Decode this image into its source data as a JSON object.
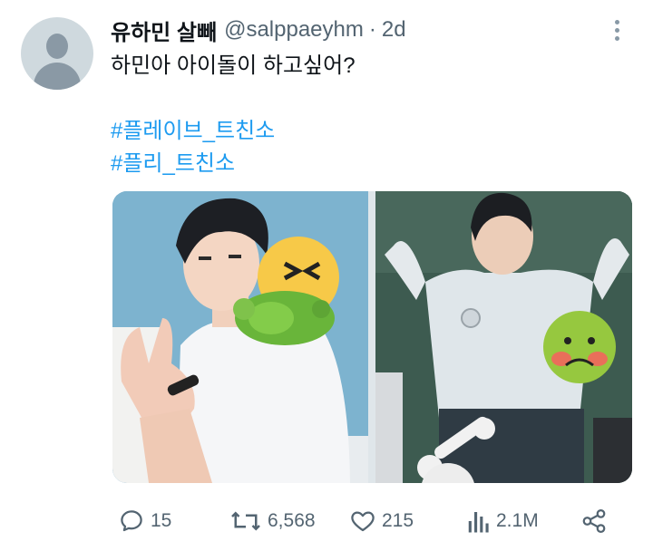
{
  "tweet": {
    "display_name": "유하민 살빼",
    "handle": "@salppaeyhm",
    "separator": "·",
    "time": "2d",
    "text": "하민아 아이돌이 하고싶어?",
    "hashtags": [
      "#플레이브_트친소",
      "#플리_트친소"
    ]
  },
  "media": [
    {
      "icon": "nauseated-vomiting-emoji",
      "description_icon": "vomit-emoji-icon"
    },
    {
      "icon": "nauseated-face-emoji",
      "description_icon": "nauseated-emoji-icon"
    }
  ],
  "actions": {
    "reply_count": "15",
    "retweet_count": "6,568",
    "like_count": "215",
    "view_count": "2.1M"
  },
  "colors": {
    "accent": "#1d9bf0",
    "secondary_text": "#536471",
    "primary_text": "#0f1419"
  }
}
